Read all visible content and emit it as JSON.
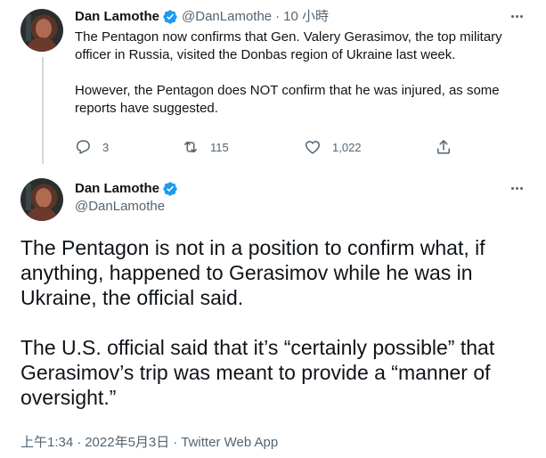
{
  "colors": {
    "text": "#0f1419",
    "muted": "#536471",
    "verified": "#1d9bf0",
    "thread_line": "#cfd9de"
  },
  "reply_tweet": {
    "author": {
      "display_name": "Dan Lamothe",
      "handle": "@DanLamothe",
      "verified_icon": "verified-badge-icon"
    },
    "separator": "·",
    "time": "10 小時",
    "text": [
      "The Pentagon now confirms that Gen. Valery Gerasimov, the top military officer in Russia, visited the Donbas region of Ukraine last week.",
      "However, the Pentagon does NOT confirm that he was injured, as some reports have suggested."
    ],
    "actions": {
      "reply": {
        "icon": "reply-icon",
        "count": "3"
      },
      "retweet": {
        "icon": "retweet-icon",
        "count": "115"
      },
      "like": {
        "icon": "heart-icon",
        "count": "1,022"
      },
      "share": {
        "icon": "share-icon"
      }
    }
  },
  "main_tweet": {
    "author": {
      "display_name": "Dan Lamothe",
      "handle": "@DanLamothe",
      "verified_icon": "verified-badge-icon"
    },
    "text": [
      "The Pentagon is not in a position to confirm what, if anything, happened to Gerasimov while he was in Ukraine, the official said.",
      "The U.S. official said that it’s “certainly possible” that Gerasimov’s trip was meant to provide a “manner of oversight.”"
    ],
    "meta": {
      "time": "上午1:34",
      "date": "2022年5月3日",
      "separator": "·",
      "source": "Twitter Web App"
    }
  }
}
